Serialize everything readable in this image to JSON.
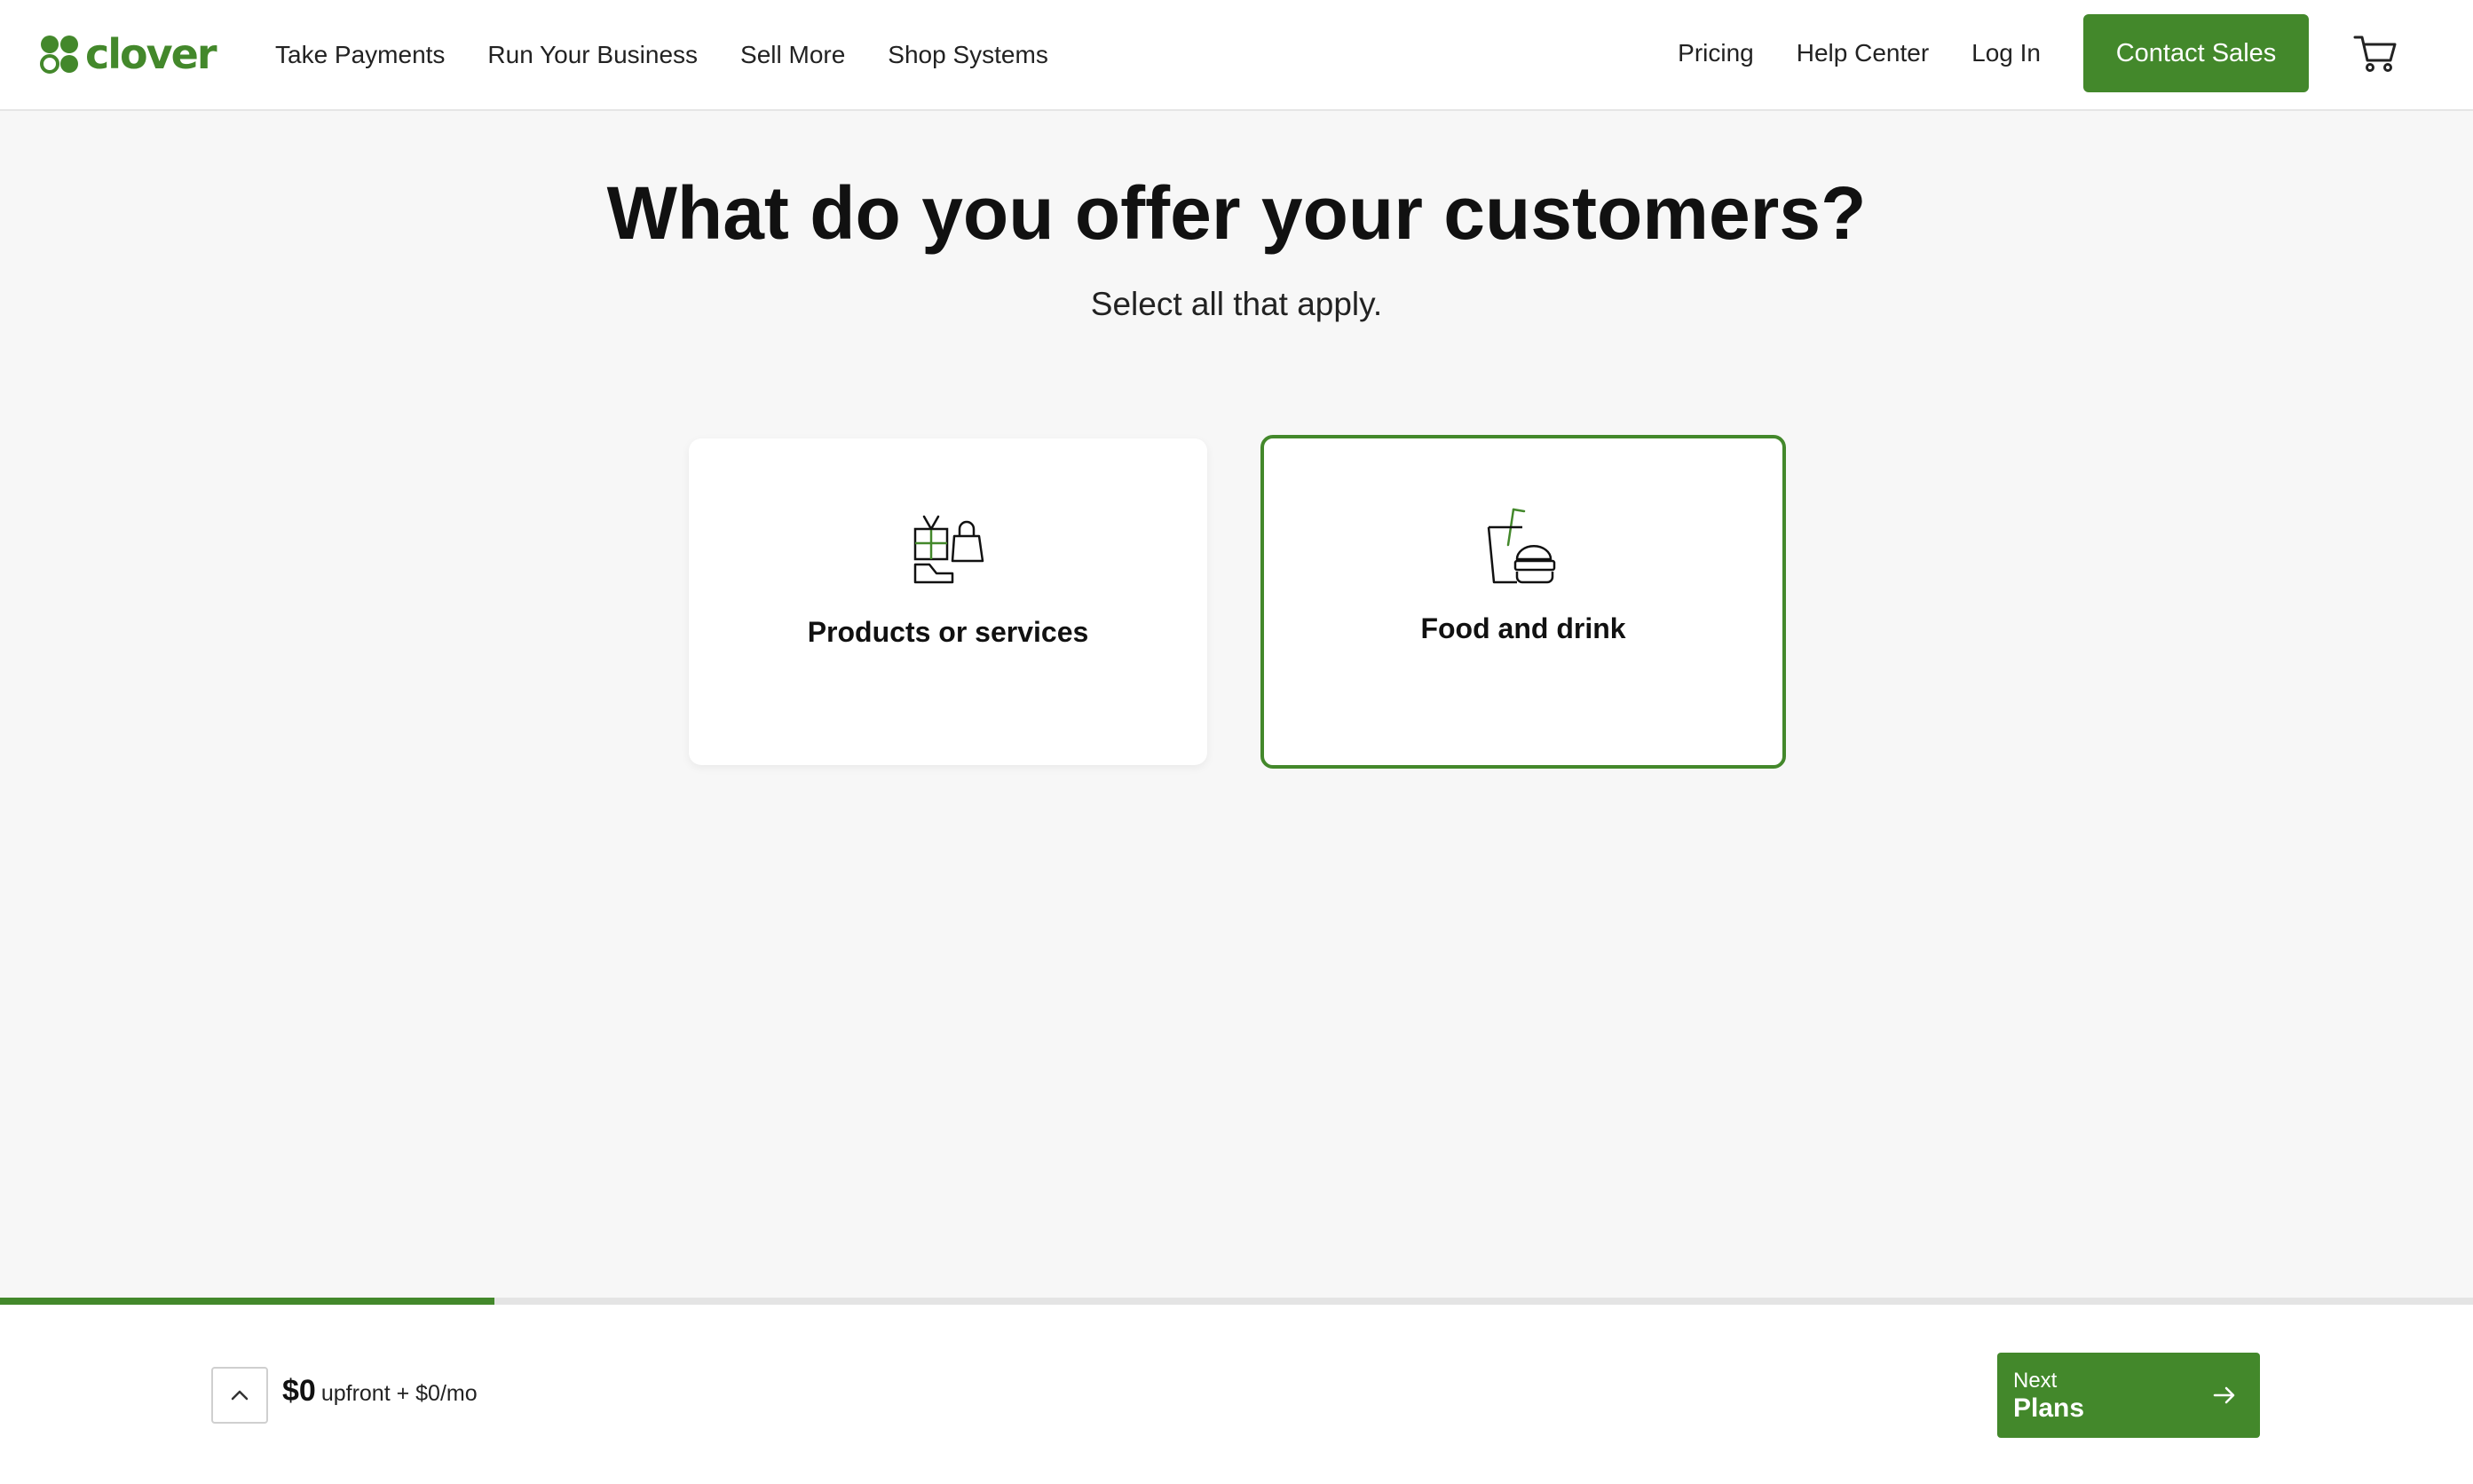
{
  "header": {
    "logo_text": "clover",
    "nav_left": [
      "Take Payments",
      "Run Your Business",
      "Sell More",
      "Shop Systems"
    ],
    "nav_right": [
      "Pricing",
      "Help Center",
      "Log In"
    ],
    "contact_label": "Contact Sales",
    "cart_icon": "shopping-cart-icon"
  },
  "main": {
    "title": "What do you offer your customers?",
    "subtitle": "Select all that apply.",
    "options": [
      {
        "label": "Products or services",
        "icon": "gift-bag-icon",
        "selected": false
      },
      {
        "label": "Food and drink",
        "icon": "drink-burger-icon",
        "selected": true
      }
    ]
  },
  "progress": {
    "fraction": 0.2
  },
  "footer": {
    "price_amount": "$0",
    "price_detail": "upfront + $0/mo",
    "expand_icon": "chevron-up-icon",
    "next_small": "Next",
    "next_big": "Plans",
    "next_icon": "arrow-right-icon"
  },
  "colors": {
    "brand": "#43882b",
    "background": "#f7f7f7",
    "card": "#ffffff"
  }
}
